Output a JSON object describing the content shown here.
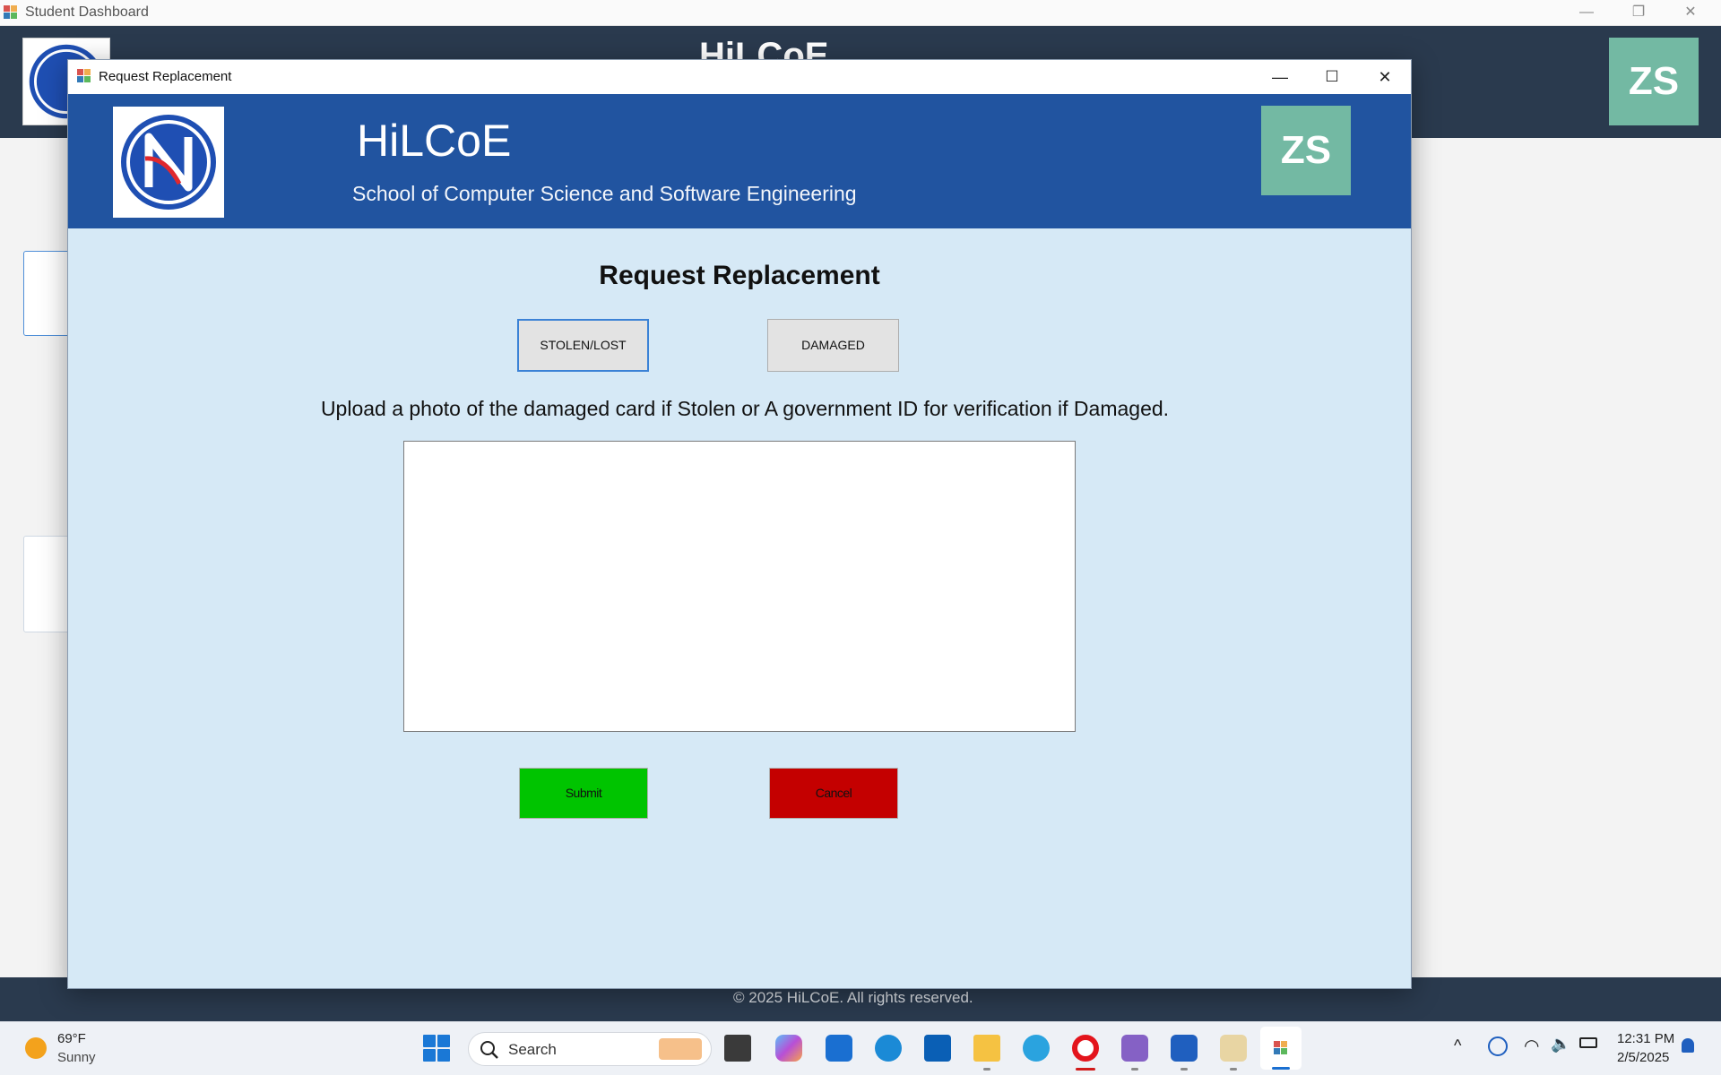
{
  "background_window": {
    "title": "Student Dashboard",
    "header_title": "HiLCoE",
    "avatar_initials": "ZS",
    "footer_text": "© 2025 HiLCoE. All rights reserved."
  },
  "dialog": {
    "window_title": "Request Replacement",
    "header": {
      "title": "HiLCoE",
      "subtitle": "School of Computer Science and Software Engineering",
      "avatar_initials": "ZS"
    },
    "heading": "Request Replacement",
    "options": [
      {
        "label": "STOLEN/LOST",
        "selected": true
      },
      {
        "label": "DAMAGED",
        "selected": false
      }
    ],
    "instruction": "Upload a photo of the damaged card if Stolen or A government ID for verification if Damaged.",
    "actions": {
      "submit_label": "Submit",
      "cancel_label": "Cancel"
    }
  },
  "colors": {
    "header_blue": "#2154a0",
    "dialog_bg": "#d6e9f6",
    "avatar_teal": "#73b9a3",
    "submit_green": "#00c400",
    "cancel_red": "#c40000",
    "dashboard_dark": "#2a3a4e"
  },
  "taskbar": {
    "weather_temp": "69°F",
    "weather_desc": "Sunny",
    "search_label": "Search",
    "time": "12:31 PM",
    "date": "2/5/2025",
    "pinned_apps": [
      "task-view-icon",
      "copilot-icon",
      "store-icon",
      "edge-icon",
      "dell-icon",
      "file-explorer-icon",
      "telegram-icon",
      "opera-icon",
      "visual-studio-icon",
      "word-icon",
      "snipping-tool-icon",
      "winforms-app-icon"
    ]
  }
}
